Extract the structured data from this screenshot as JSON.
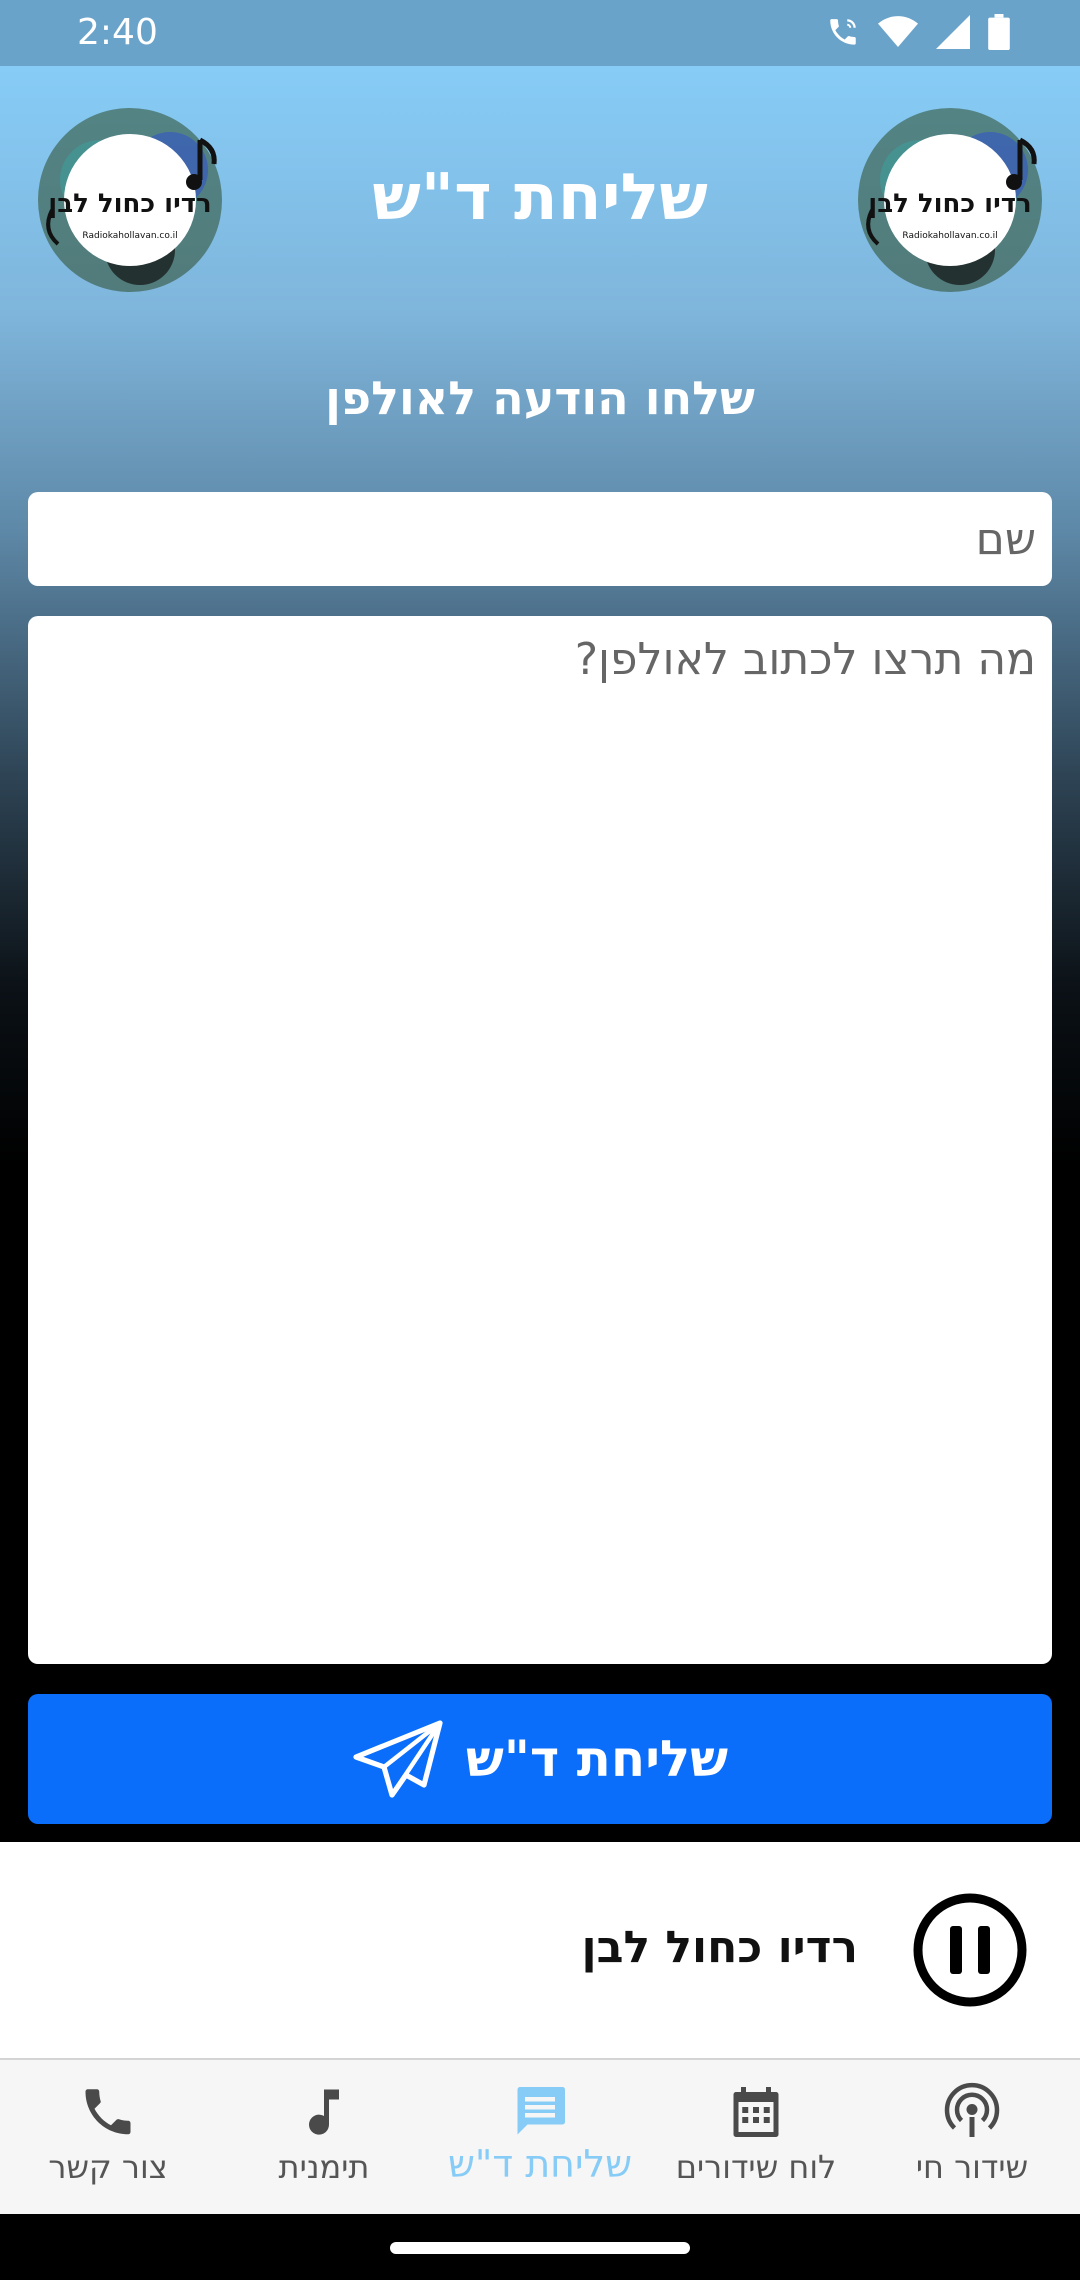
{
  "status_bar": {
    "time": "2:40",
    "icons": [
      "wifi-calling-icon",
      "wifi-icon",
      "signal-icon",
      "battery-icon"
    ]
  },
  "header": {
    "title": "שליחת ד\"ש",
    "logo_text": "רדיו כחול לבן",
    "logo_url_text": "Radiokahollavan.co.il"
  },
  "form": {
    "heading": "שלחו הודעה לאולפן",
    "name_placeholder": "שם",
    "message_placeholder": "מה תרצו לכתוב לאולפן?",
    "send_label": "שליחת ד\"ש",
    "send_icon": "paper-plane-icon"
  },
  "player": {
    "station": "רדיו כחול לבן",
    "state_icon": "pause-icon"
  },
  "nav": {
    "items": [
      {
        "label": "שידור חי",
        "icon": "podcast-icon",
        "active": false
      },
      {
        "label": "לוח שידורים",
        "icon": "calendar-icon",
        "active": false
      },
      {
        "label": "שליחת ד\"ש",
        "icon": "message-icon",
        "active": true
      },
      {
        "label": "תימנית",
        "icon": "music-note-icon",
        "active": false
      },
      {
        "label": "צור קשר",
        "icon": "phone-icon",
        "active": false
      }
    ]
  },
  "colors": {
    "accent": "#0a6efa",
    "active_tab": "#86ccf7",
    "status_bar": "#6aa3c9",
    "gradient_top": "#86ccf7"
  }
}
